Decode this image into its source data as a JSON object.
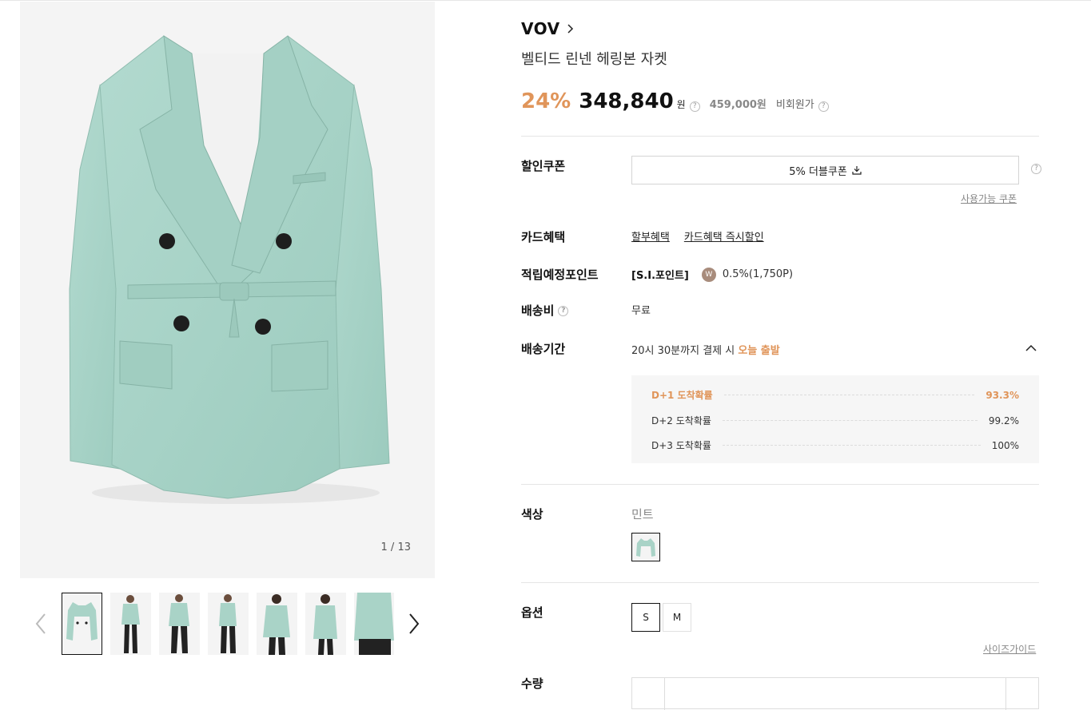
{
  "gallery": {
    "counter": "1 / 13",
    "thumbnails": [
      "thumb-1",
      "thumb-2",
      "thumb-3",
      "thumb-4",
      "thumb-5",
      "thumb-6",
      "thumb-7"
    ]
  },
  "product": {
    "brand": "VOV",
    "name": "벨티드 린넨 헤링본 자켓",
    "discount": "24%",
    "price": "348,840",
    "price_unit": "원",
    "original_price": "459,000원",
    "member_price_label": "비회원가",
    "help_glyph": "?"
  },
  "benefits": {
    "coupon_label": "할인쿠폰",
    "coupon_button": "5% 더블쿠폰",
    "available_coupons": "사용가능 쿠폰",
    "card_label": "카드혜택",
    "card_links": [
      "할부혜택",
      "카드혜택 즉시할인"
    ],
    "points_label": "적립예정포인트",
    "points_type": "[S.I.포인트]",
    "points_badge": "W",
    "points_value": "0.5%(1,750P)",
    "shipping_fee_label": "배송비",
    "shipping_fee_value": "무료",
    "shipping_time_label": "배송기간",
    "shipping_time_prefix": "20시 30분까지 결제 시 ",
    "shipping_time_highlight": "오늘 출발",
    "arrival": [
      {
        "label": "D+1 도착확률",
        "value": "93.3%"
      },
      {
        "label": "D+2 도착확률",
        "value": "99.2%"
      },
      {
        "label": "D+3 도착확률",
        "value": "100%"
      }
    ]
  },
  "options": {
    "color_label": "색상",
    "color_name": "민트",
    "option_label": "옵션",
    "sizes": [
      "S",
      "M"
    ],
    "size_guide": "사이즈가이드",
    "quantity_label": "수량"
  },
  "colors": {
    "accent": "#e0955a",
    "jacket": "#a9d3c7"
  }
}
